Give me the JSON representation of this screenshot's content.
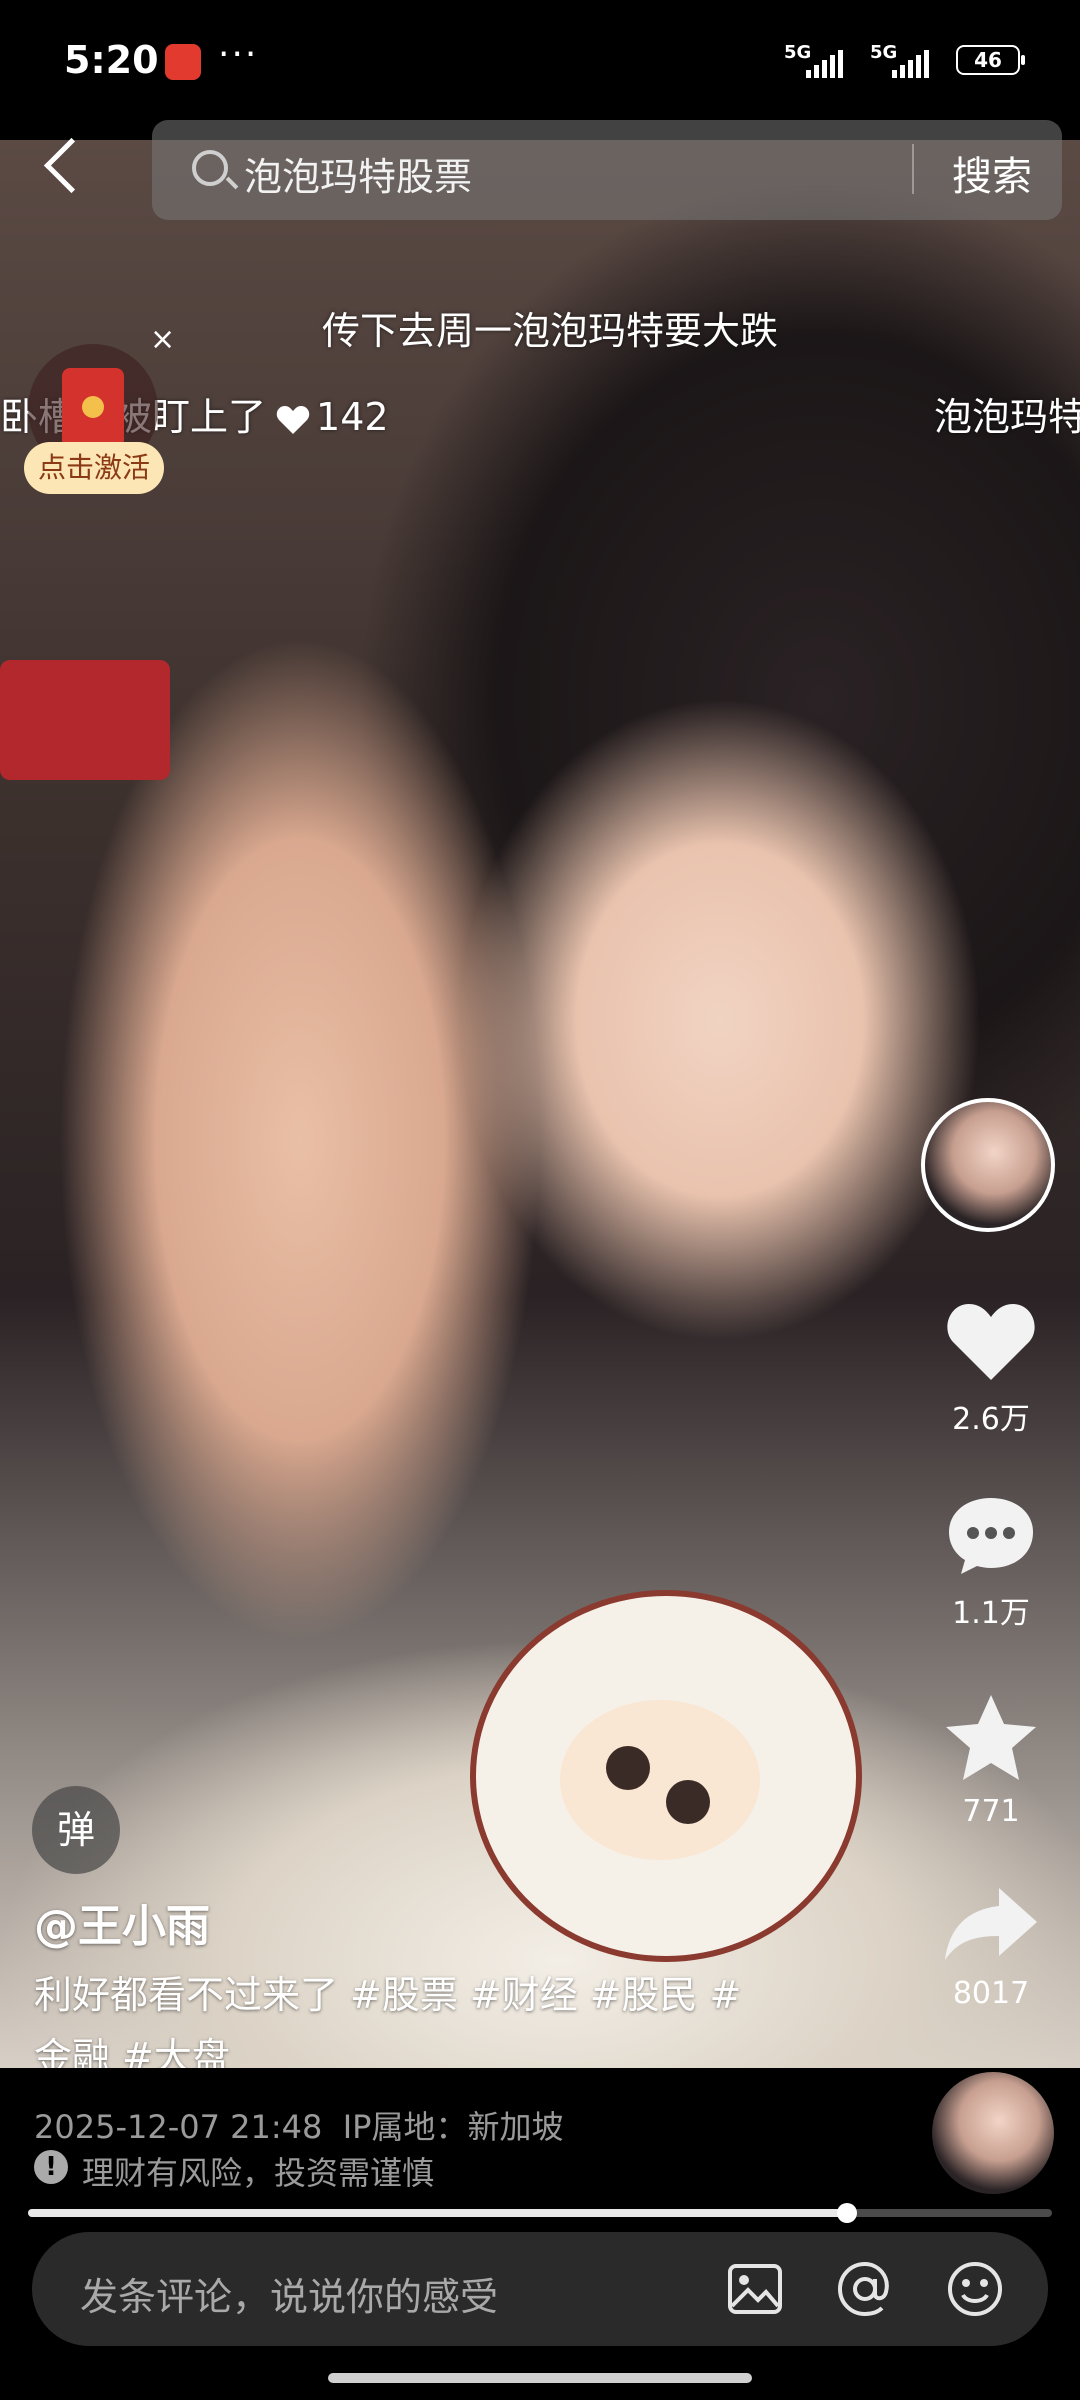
{
  "status_bar": {
    "time": "5:20",
    "overflow": "···",
    "network1": "5G",
    "network2": "5G",
    "battery": "46"
  },
  "search": {
    "query": "泡泡玛特股票",
    "button_label": "搜索"
  },
  "danmaku": {
    "line1": "传下去周一泡泡玛特要大跌",
    "line2_left": "卧槽我被盯上了",
    "line2_likes": "142",
    "line2_right": "泡泡玛特"
  },
  "redpacket": {
    "close": "×",
    "label": "点击激活"
  },
  "sidebar": {
    "likes": "2.6万",
    "comments": "1.1万",
    "favorites": "771",
    "shares": "8017"
  },
  "danmu_toggle": "弹",
  "post": {
    "author": "@王小雨",
    "caption_text": "利好都看不过来了",
    "tags": [
      "#股票",
      "#财经",
      "#股民",
      "#",
      "金融",
      "#大盘"
    ],
    "datetime": "2025-12-07 21:48",
    "ip_location": "IP属地：新加坡",
    "risk_notice": "理财有风险，投资需谨慎"
  },
  "playback": {
    "progress_percent": 80
  },
  "comment_bar": {
    "placeholder": "发条评论，说说你的感受"
  },
  "icons": {
    "back": "back-icon",
    "search": "search-icon",
    "like": "heart-icon",
    "comment": "comment-icon",
    "favorite": "star-icon",
    "share": "share-icon",
    "image": "image-icon",
    "mention": "at-icon",
    "emoji": "emoji-icon"
  }
}
